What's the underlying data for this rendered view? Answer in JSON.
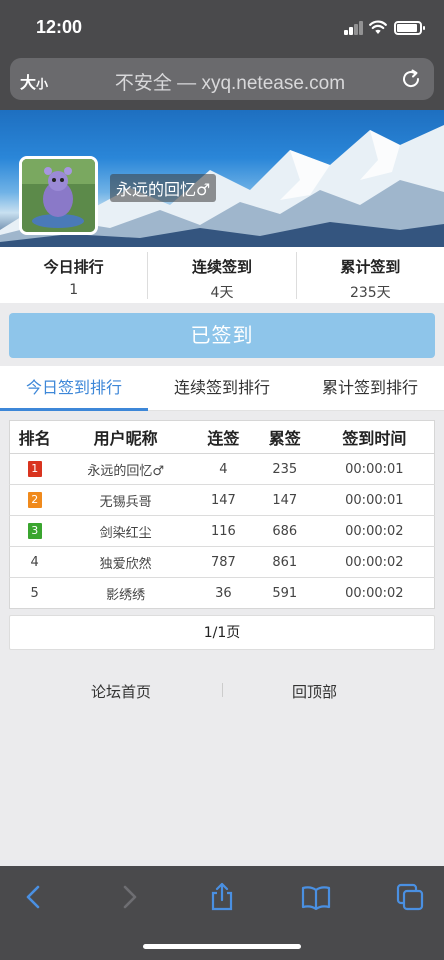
{
  "status": {
    "time": "12:00"
  },
  "browser": {
    "text_size_label": "大",
    "text_size_small": "小",
    "url": "不安全 — xyq.netease.com"
  },
  "header": {
    "username": "永远的回忆♂"
  },
  "stats": [
    {
      "label": "今日排行",
      "value": "1"
    },
    {
      "label": "连续签到",
      "value": "4天"
    },
    {
      "label": "累计签到",
      "value": "235天"
    }
  ],
  "signed_button": "已签到",
  "tabs": [
    {
      "label": "今日签到排行",
      "active": true
    },
    {
      "label": "连续签到排行",
      "active": false
    },
    {
      "label": "累计签到排行",
      "active": false
    }
  ],
  "table": {
    "headers": [
      "排名",
      "用户昵称",
      "连签",
      "累签",
      "签到时间"
    ],
    "rows": [
      {
        "rank": "1",
        "nick": "永远的回忆♂",
        "streak": "4",
        "total": "235",
        "time": "00:00:01"
      },
      {
        "rank": "2",
        "nick": "无锡兵哥",
        "streak": "147",
        "total": "147",
        "time": "00:00:01"
      },
      {
        "rank": "3",
        "nick": "剑染红尘",
        "streak": "116",
        "total": "686",
        "time": "00:00:02"
      },
      {
        "rank": "4",
        "nick": "独爱欣然",
        "streak": "787",
        "total": "861",
        "time": "00:00:02"
      },
      {
        "rank": "5",
        "nick": "影绣绣",
        "streak": "36",
        "total": "591",
        "time": "00:00:02"
      }
    ],
    "medal_colors": [
      "#d9341f",
      "#f08a1c",
      "#3aa52f"
    ],
    "highlight_nick_color": "#e040c0"
  },
  "pager": "1/1页",
  "footer": {
    "forum_home": "论坛首页",
    "back_to_top": "回顶部"
  },
  "colors": {
    "accent": "#3d87d8",
    "signed_button": "#8ec5ea",
    "toolbar": "#4a4a4c"
  },
  "toolbar_icons": [
    "back-icon",
    "forward-icon",
    "share-icon",
    "bookmarks-icon",
    "tabs-icon"
  ]
}
